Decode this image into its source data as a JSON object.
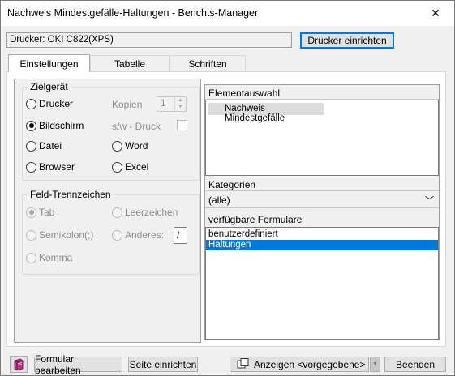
{
  "window": {
    "title": "Nachweis Mindestgefälle-Haltungen - Berichts-Manager",
    "close_glyph": "✕"
  },
  "printer": {
    "field_text": "Drucker:  OKI C822(XPS)",
    "setup_button": "Drucker einrichten"
  },
  "tabs": [
    {
      "label": "Einstellungen",
      "active": true
    },
    {
      "label": "Tabelle",
      "active": false
    },
    {
      "label": "Schriften",
      "active": false
    }
  ],
  "target": {
    "group_title": "Zielgerät",
    "options": {
      "printer": "Drucker",
      "screen": "Bildschirm",
      "file": "Datei",
      "browser": "Browser",
      "word": "Word",
      "excel": "Excel"
    },
    "selected": "Bildschirm",
    "copies_label": "Kopien",
    "copies_value": "1",
    "bw_print_label": "s/w - Druck"
  },
  "field_separator": {
    "group_title": "Feld-Trennzeichen",
    "options": {
      "tab": "Tab",
      "space": "Leerzeichen",
      "semicolon": "Semikolon(;)",
      "other": "Anderes:",
      "comma": "Komma"
    },
    "selected": "Tab",
    "other_value": "/"
  },
  "element_selection": {
    "header": "Elementauswahl",
    "items": [
      "Nachweis Mindestgefälle"
    ]
  },
  "categories": {
    "header": "Kategorien",
    "selected": "(alle)"
  },
  "forms": {
    "header": "verfügbare Formulare",
    "items": [
      {
        "label": "benutzerdefiniert",
        "selected": false
      },
      {
        "label": "Haltungen",
        "selected": true
      }
    ]
  },
  "bottom_bar": {
    "edit_form": "Formular bearbeiten",
    "page_setup": "Seite einrichten",
    "show": "Anzeigen <vorgegebene>",
    "close": "Beenden"
  },
  "colors": {
    "accent": "#0078d7",
    "selection": "#0078d7"
  }
}
